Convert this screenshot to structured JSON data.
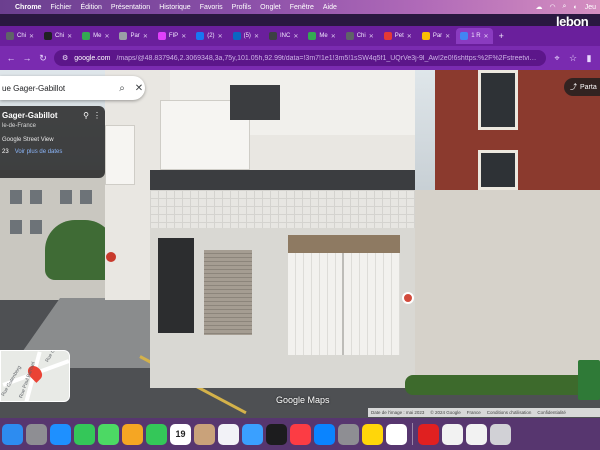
{
  "menubar": {
    "app_name": "Chrome",
    "items": [
      "Fichier",
      "Édition",
      "Présentation",
      "Historique",
      "Favoris",
      "Profils",
      "Onglet",
      "Fenêtre",
      "Aide"
    ],
    "clock": "Jeu"
  },
  "corner_brand": "lebon",
  "tabs": [
    {
      "label": "Chi",
      "color": "#5f6368"
    },
    {
      "label": "Chi",
      "color": "#202124"
    },
    {
      "label": "Me",
      "color": "#34a853"
    },
    {
      "label": "Par",
      "color": "#9aa0a6"
    },
    {
      "label": "FIP",
      "color": "#e040fb"
    },
    {
      "label": "(2)",
      "color": "#1877f2"
    },
    {
      "label": "(5)",
      "color": "#0a66c2"
    },
    {
      "label": "INC",
      "color": "#3c4043"
    },
    {
      "label": "Me",
      "color": "#34a853"
    },
    {
      "label": "Chi",
      "color": "#5f6368"
    },
    {
      "label": "Pet",
      "color": "#e53935"
    },
    {
      "label": "Par",
      "color": "#fbbc04"
    },
    {
      "label": "1 R",
      "color": "#4285f4"
    }
  ],
  "address_bar": {
    "host": "google.com",
    "path": "/maps/@48.837946,2.3069348,3a,75y,101.05h,92.99t/data=!3m7!1e1!3m5!1sSW4q5f1_UQrVe3j-9l_Aw!2e0!6shttps:%2F%2Fstreetviewpixels-p..."
  },
  "search": {
    "query": "ue Gager-Gabillot"
  },
  "info_card": {
    "title": "Gager-Gabillot",
    "region": "le-de-France",
    "source": "Google Street View",
    "date_prefix": "23",
    "more_dates_link": "Voir plus de dates"
  },
  "share": {
    "label": "Parta"
  },
  "minimap": {
    "label_1": "Rue Gager-Gabillot",
    "label_2": "Rue Paul Barruel",
    "label_3": "Rue Gutenberg"
  },
  "branding": {
    "maps_logo": "Google Maps"
  },
  "attribution": {
    "capture_date": "Date de l'image : mai 2023",
    "copyright": "© 2024 Google",
    "country": "France",
    "terms": "Conditions d'utilisation",
    "privacy": "Confidentialité"
  },
  "dock": {
    "calendar_day": "19",
    "apps": [
      {
        "name": "finder",
        "color": "#2d8cf0"
      },
      {
        "name": "launchpad",
        "color": "#8e8e93"
      },
      {
        "name": "safari",
        "color": "#1e90ff"
      },
      {
        "name": "messages",
        "color": "#34c759"
      },
      {
        "name": "maps",
        "color": "#4cd964"
      },
      {
        "name": "photos",
        "color": "#f5a623"
      },
      {
        "name": "facetime",
        "color": "#34c759"
      },
      {
        "name": "calendar",
        "color": "#ffffff"
      },
      {
        "name": "contacts",
        "color": "#c9a27a"
      },
      {
        "name": "reminders",
        "color": "#f2f2f7"
      },
      {
        "name": "freeform",
        "color": "#3aa0ff"
      },
      {
        "name": "tv",
        "color": "#1c1c1e"
      },
      {
        "name": "music",
        "color": "#fc3c44"
      },
      {
        "name": "appstore",
        "color": "#0a84ff"
      },
      {
        "name": "settings",
        "color": "#8e8e93"
      },
      {
        "name": "notes",
        "color": "#ffd60a"
      },
      {
        "name": "chrome",
        "color": "#ffffff"
      },
      {
        "name": "acrobat",
        "color": "#e02020"
      },
      {
        "name": "document",
        "color": "#f2f2f2"
      },
      {
        "name": "document-red",
        "color": "#f2f2f2"
      },
      {
        "name": "trash",
        "color": "#d1d1d6"
      }
    ]
  }
}
